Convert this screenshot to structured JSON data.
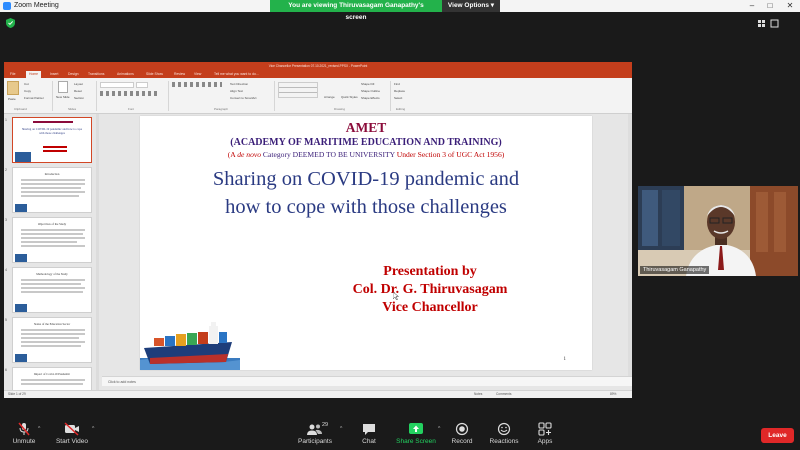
{
  "window": {
    "title": "Zoom Meeting",
    "viewing_banner": "You are viewing Thiruvasagam Ganapathy's screen",
    "view_options": "View Options",
    "minimize": "–",
    "maximize": "□",
    "close": "✕"
  },
  "share": {
    "ppt_title": "Vice Chancellor Presentation 07.10.2021_revised.PPSX - PowerPoint",
    "tabs": [
      "File",
      "Home",
      "Insert",
      "Design",
      "Transitions",
      "Animations",
      "Slide Show",
      "Review",
      "View",
      "Tell me what you want to do..."
    ],
    "ribbon": {
      "paste": "Paste",
      "cut": "Cut",
      "copy": "Copy",
      "format_painter": "Format Painter",
      "new_slide": "New Slide",
      "layout": "Layout",
      "reset": "Reset",
      "section": "Section",
      "text_direction": "Text Direction",
      "align_text": "Align Text",
      "convert_smartart": "Convert to SmartArt",
      "arrange": "Arrange",
      "quick_styles": "Quick Styles",
      "shape_fill": "Shape Fill",
      "shape_outline": "Shape Outline",
      "shape_effects": "Shape Effects",
      "find": "Find",
      "replace": "Replace",
      "select": "Select",
      "groups": [
        "Clipboard",
        "Slides",
        "Font",
        "Paragraph",
        "Drawing",
        "Editing"
      ]
    },
    "thumbs": [
      {
        "num": "1",
        "title": "Sharing on COVID-19 pandemic and how to cope with those challenges"
      },
      {
        "num": "2",
        "title": "Introduction"
      },
      {
        "num": "3",
        "title": "Objectives of the Study"
      },
      {
        "num": "4",
        "title": "Methodology of the Study"
      },
      {
        "num": "5",
        "title": "Status of the Education Sector"
      },
      {
        "num": "6",
        "title": "Impact of Covid-19 Pandemic"
      }
    ],
    "slide": {
      "amet": "AMET",
      "academy": "(ACADEMY OF MARITIME EDUCATION AND TRAINING)",
      "deemed_a": "(A ",
      "deemed_italic": "de novo",
      "deemed_b": " Category DEEMED TO BE UNIVERSITY ",
      "deemed_c": "Under Section 3 of UGC Act 1956)",
      "main_line1": "Sharing on COVID-19 pandemic and",
      "main_line2": "how to cope with those challenges",
      "presentation_by": "Presentation by",
      "presenter": "Col. Dr. G. Thiruvasagam",
      "role": "Vice Chancellor",
      "page_number": "1"
    },
    "notes": "Click to add notes",
    "status_left": "Slide 1 of 29",
    "status_notes": "Notes",
    "status_comments": "Comments",
    "status_zoom": "89%"
  },
  "video": {
    "participant_name": "Thiruvasagam Ganapathy"
  },
  "toolbar": {
    "unmute": "Unmute",
    "start_video": "Start Video",
    "participants": "Participants",
    "participants_count": "29",
    "chat": "Chat",
    "share_screen": "Share Screen",
    "record": "Record",
    "reactions": "Reactions",
    "apps": "Apps",
    "leave": "Leave"
  },
  "colors": {
    "zoom_green": "#23b24b",
    "ppt_orange": "#c43e1c",
    "leave_red": "#e02828",
    "slide_maroon": "#8b0b3a",
    "slide_blue": "#2a3a82",
    "slide_red": "#c00000"
  }
}
